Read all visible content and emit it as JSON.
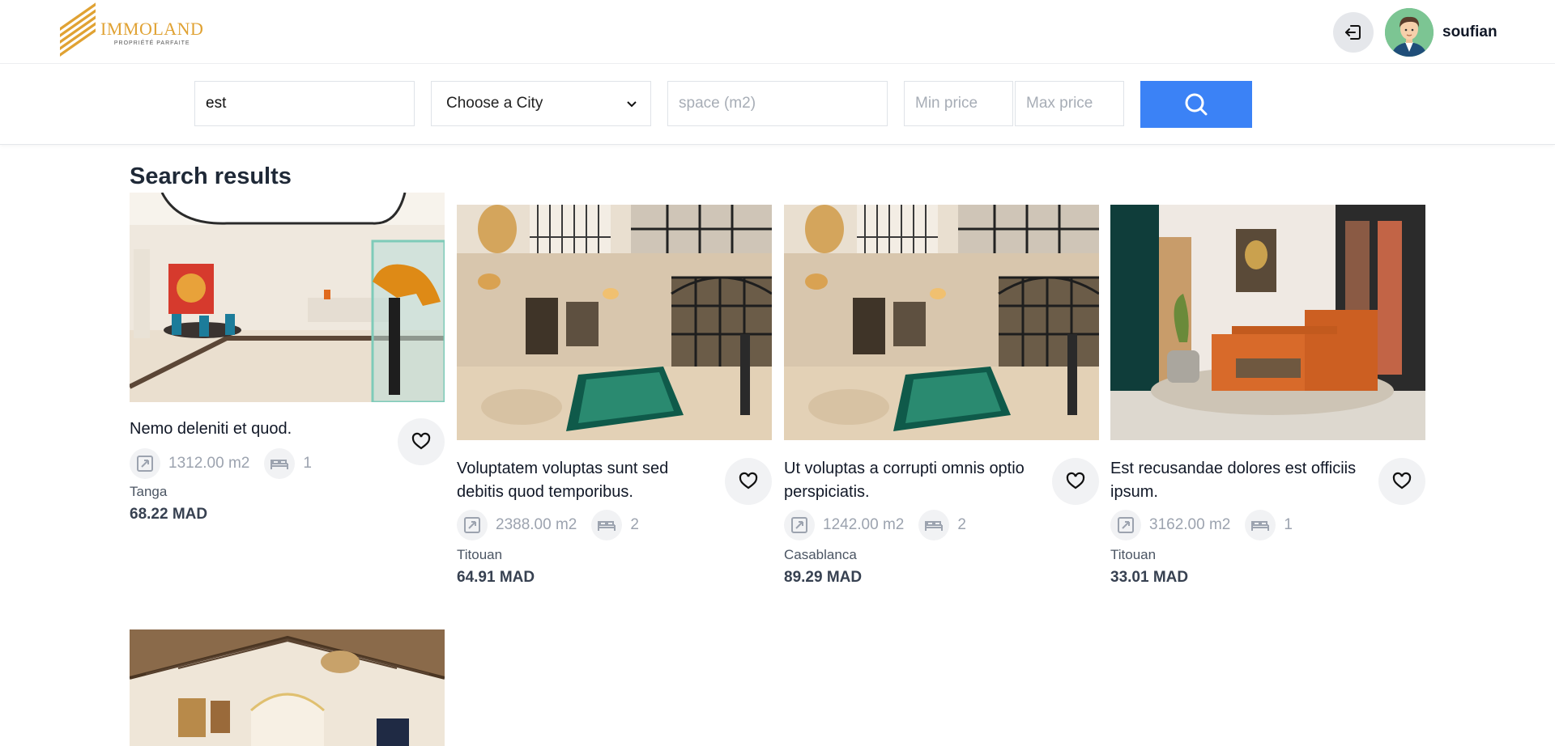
{
  "brand": {
    "name": "IMMOLAND",
    "tagline": "PROPRIÉTÉ PARFAITE",
    "color": "#e0a233"
  },
  "header": {
    "logout_icon": "logout-icon",
    "username": "soufian"
  },
  "search": {
    "keyword_value": "est",
    "city_selected": "Choose a City",
    "space_placeholder": "space (m2)",
    "min_price_placeholder": "Min price",
    "max_price_placeholder": "Max price",
    "button_icon": "search-icon",
    "button_color": "#3b82f6"
  },
  "results": {
    "title": "Search results",
    "cards": [
      {
        "title": "Nemo deleniti et quod.",
        "space": "1312.00 m2",
        "rooms": "1",
        "city": "Tanga",
        "price": "68.22 MAD"
      },
      {
        "title": "Voluptatem voluptas sunt sed debitis quod temporibus.",
        "space": "2388.00 m2",
        "rooms": "2",
        "city": "Titouan",
        "price": "64.91 MAD"
      },
      {
        "title": "Ut voluptas a corrupti omnis optio perspiciatis.",
        "space": "1242.00 m2",
        "rooms": "2",
        "city": "Casablanca",
        "price": "89.29 MAD"
      },
      {
        "title": "Est recusandae dolores est officiis ipsum.",
        "space": "3162.00 m2",
        "rooms": "1",
        "city": "Titouan",
        "price": "33.01 MAD"
      }
    ]
  }
}
